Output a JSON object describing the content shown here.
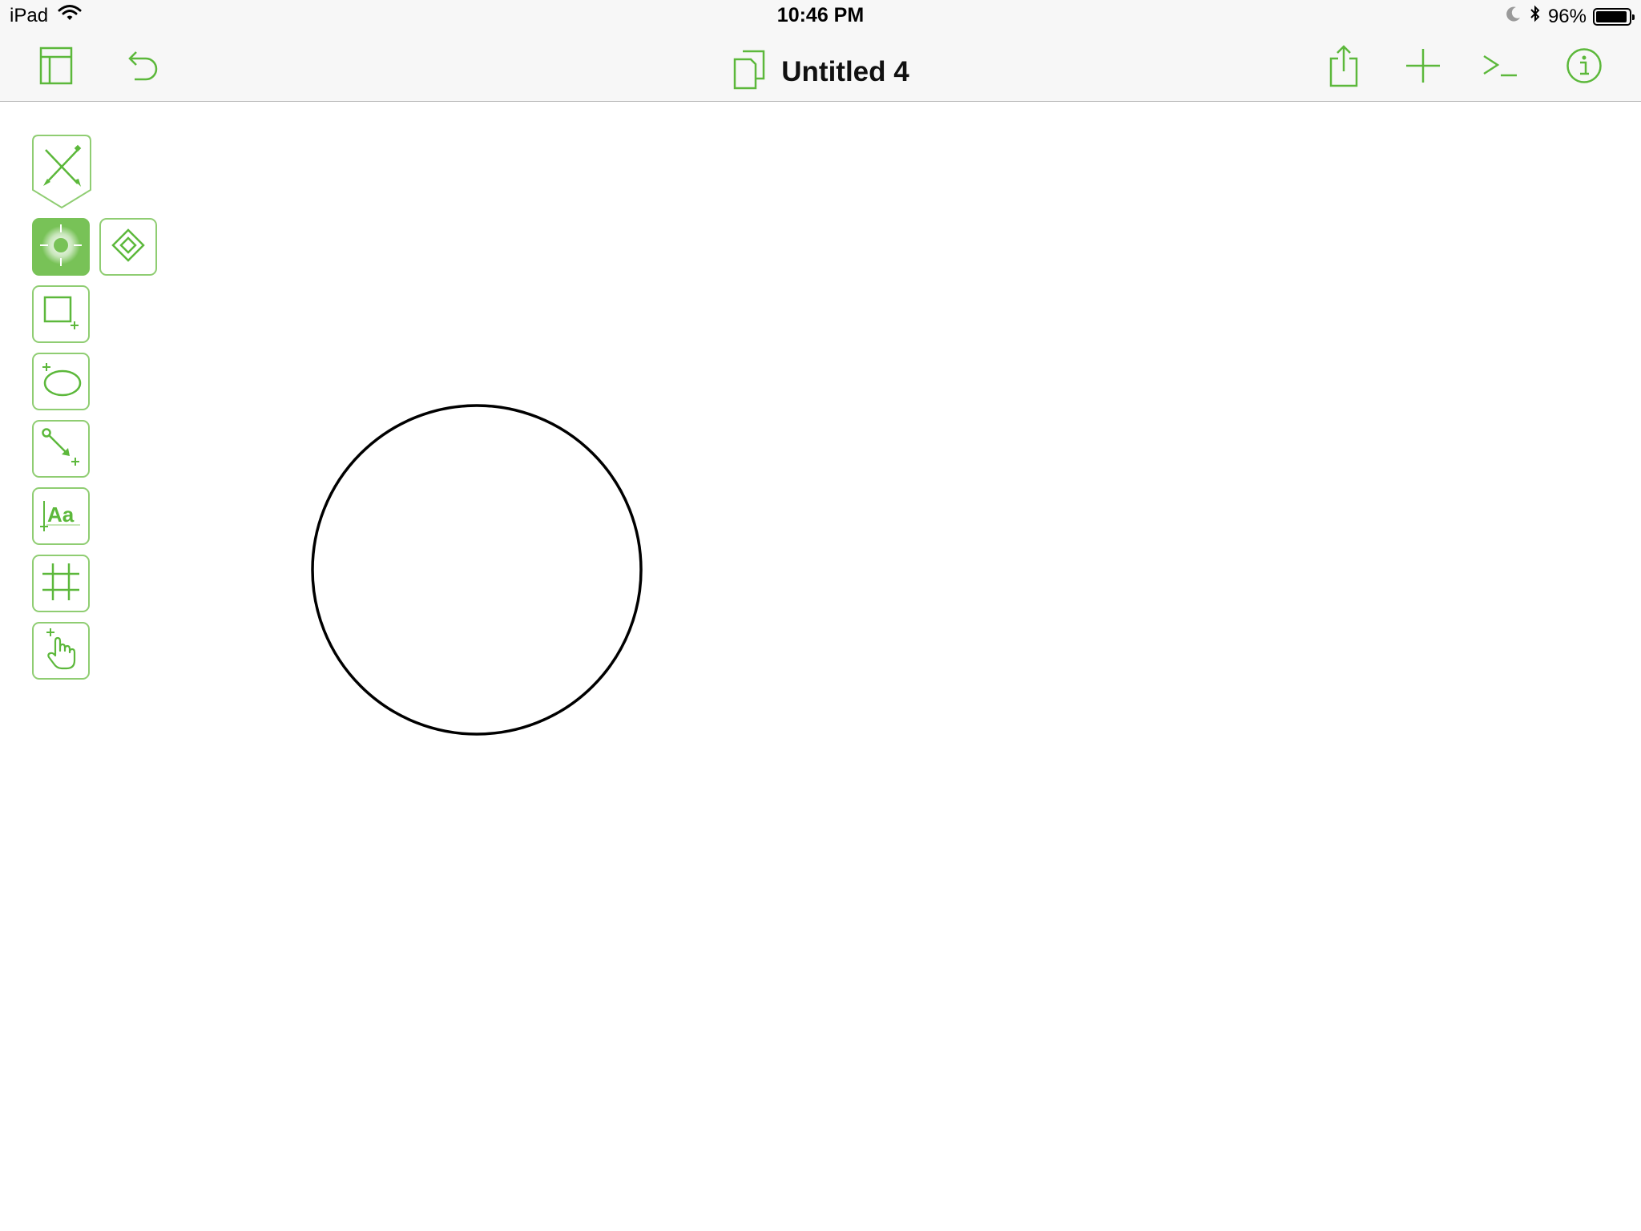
{
  "status_bar": {
    "device": "iPad",
    "time": "10:46 PM",
    "battery_percent": "96%",
    "battery_level": 0.96,
    "icons": [
      "wifi-icon",
      "moon-icon",
      "bluetooth-icon",
      "battery-icon"
    ]
  },
  "toolbar": {
    "document_title": "Untitled 4",
    "left_icons": [
      "sidebar-icon",
      "undo-icon"
    ],
    "right_icons": [
      "share-icon",
      "add-icon",
      "console-icon",
      "info-icon"
    ]
  },
  "tools": {
    "items": [
      {
        "name": "drawing-tools-toggle",
        "icon": "pen-pencil-icon",
        "selected": false
      },
      {
        "name": "selection-tool",
        "icon": "target-icon",
        "selected": true
      },
      {
        "name": "point-editor-tool",
        "icon": "diamond-icon",
        "selected": false
      },
      {
        "name": "rectangle-tool",
        "icon": "rectangle-icon",
        "selected": false
      },
      {
        "name": "ellipse-tool",
        "icon": "ellipse-icon",
        "selected": false
      },
      {
        "name": "line-tool",
        "icon": "line-icon",
        "selected": false
      },
      {
        "name": "text-tool",
        "icon": "text-icon",
        "label": "Aa",
        "selected": false
      },
      {
        "name": "table-tool",
        "icon": "grid-icon",
        "selected": false
      },
      {
        "name": "touch-tool",
        "icon": "hand-icon",
        "selected": false
      }
    ]
  },
  "colors": {
    "accent": "#5cb83b",
    "tool_border": "#8fcd72",
    "selected_tool": "#78c257",
    "bar_background": "#f7f7f7",
    "shape_stroke": "#000000"
  },
  "canvas": {
    "shapes": [
      {
        "type": "circle",
        "fill": "none",
        "stroke": "#000000"
      }
    ]
  }
}
